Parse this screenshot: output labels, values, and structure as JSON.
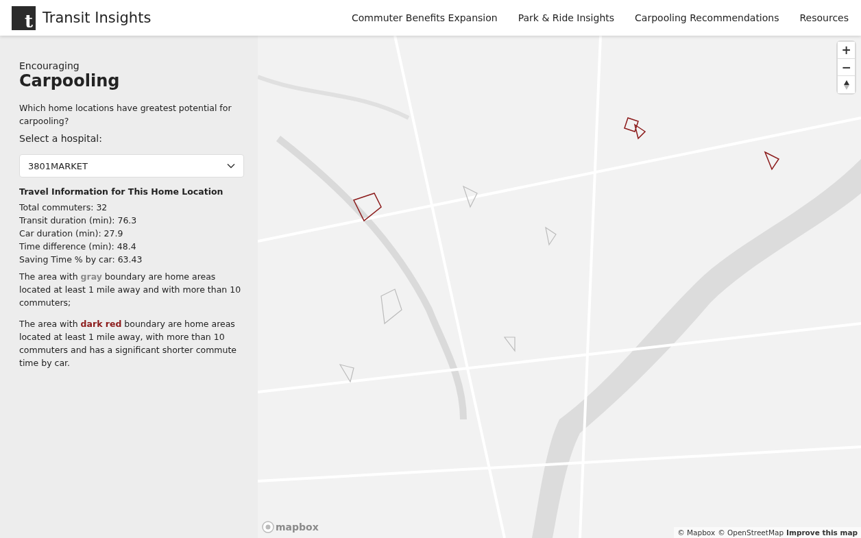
{
  "header": {
    "logo_letter": "t",
    "title": "Transit Insights",
    "nav": [
      {
        "label": "Commuter Benefits Expansion",
        "selected": false
      },
      {
        "label": "Park & Ride Insights",
        "selected": false
      },
      {
        "label": "Carpooling Recommendations",
        "selected": false
      },
      {
        "label": "Resources",
        "selected": false
      }
    ]
  },
  "sidebar": {
    "kicker": "Encouraging",
    "heading": "Carpooling",
    "question": "Which home locations have greatest potential for carpooling?",
    "select_label": "Select a hospital:",
    "select": {
      "value": "3801MARKET"
    },
    "info_title": "Travel Information for This Home Location",
    "info_lines": [
      "Total commuters: 32",
      "Transit duration (min): 76.3",
      "Car duration (min): 27.9",
      "Time difference (min): 48.4",
      "Saving Time % by car: 63.43"
    ],
    "legend": [
      {
        "text": "The area with **gray** boundary are home areas located at least 1 mile away and with more than 10 commuters;",
        "color": "#8a8a8a"
      },
      {
        "text": "The area with **dark red** boundary are home areas located at least 1 mile away, with more than 10 commuters and has a significant shorter commute time by car.",
        "color": "#8b1a1a"
      }
    ]
  },
  "map": {
    "kind": "picture",
    "zoom_controls": [
      "+",
      "−"
    ],
    "logo_text": "mapbox",
    "attribution": [
      "© Mapbox",
      "© OpenStreetMap"
    ],
    "improve_link": "Improve this map"
  }
}
